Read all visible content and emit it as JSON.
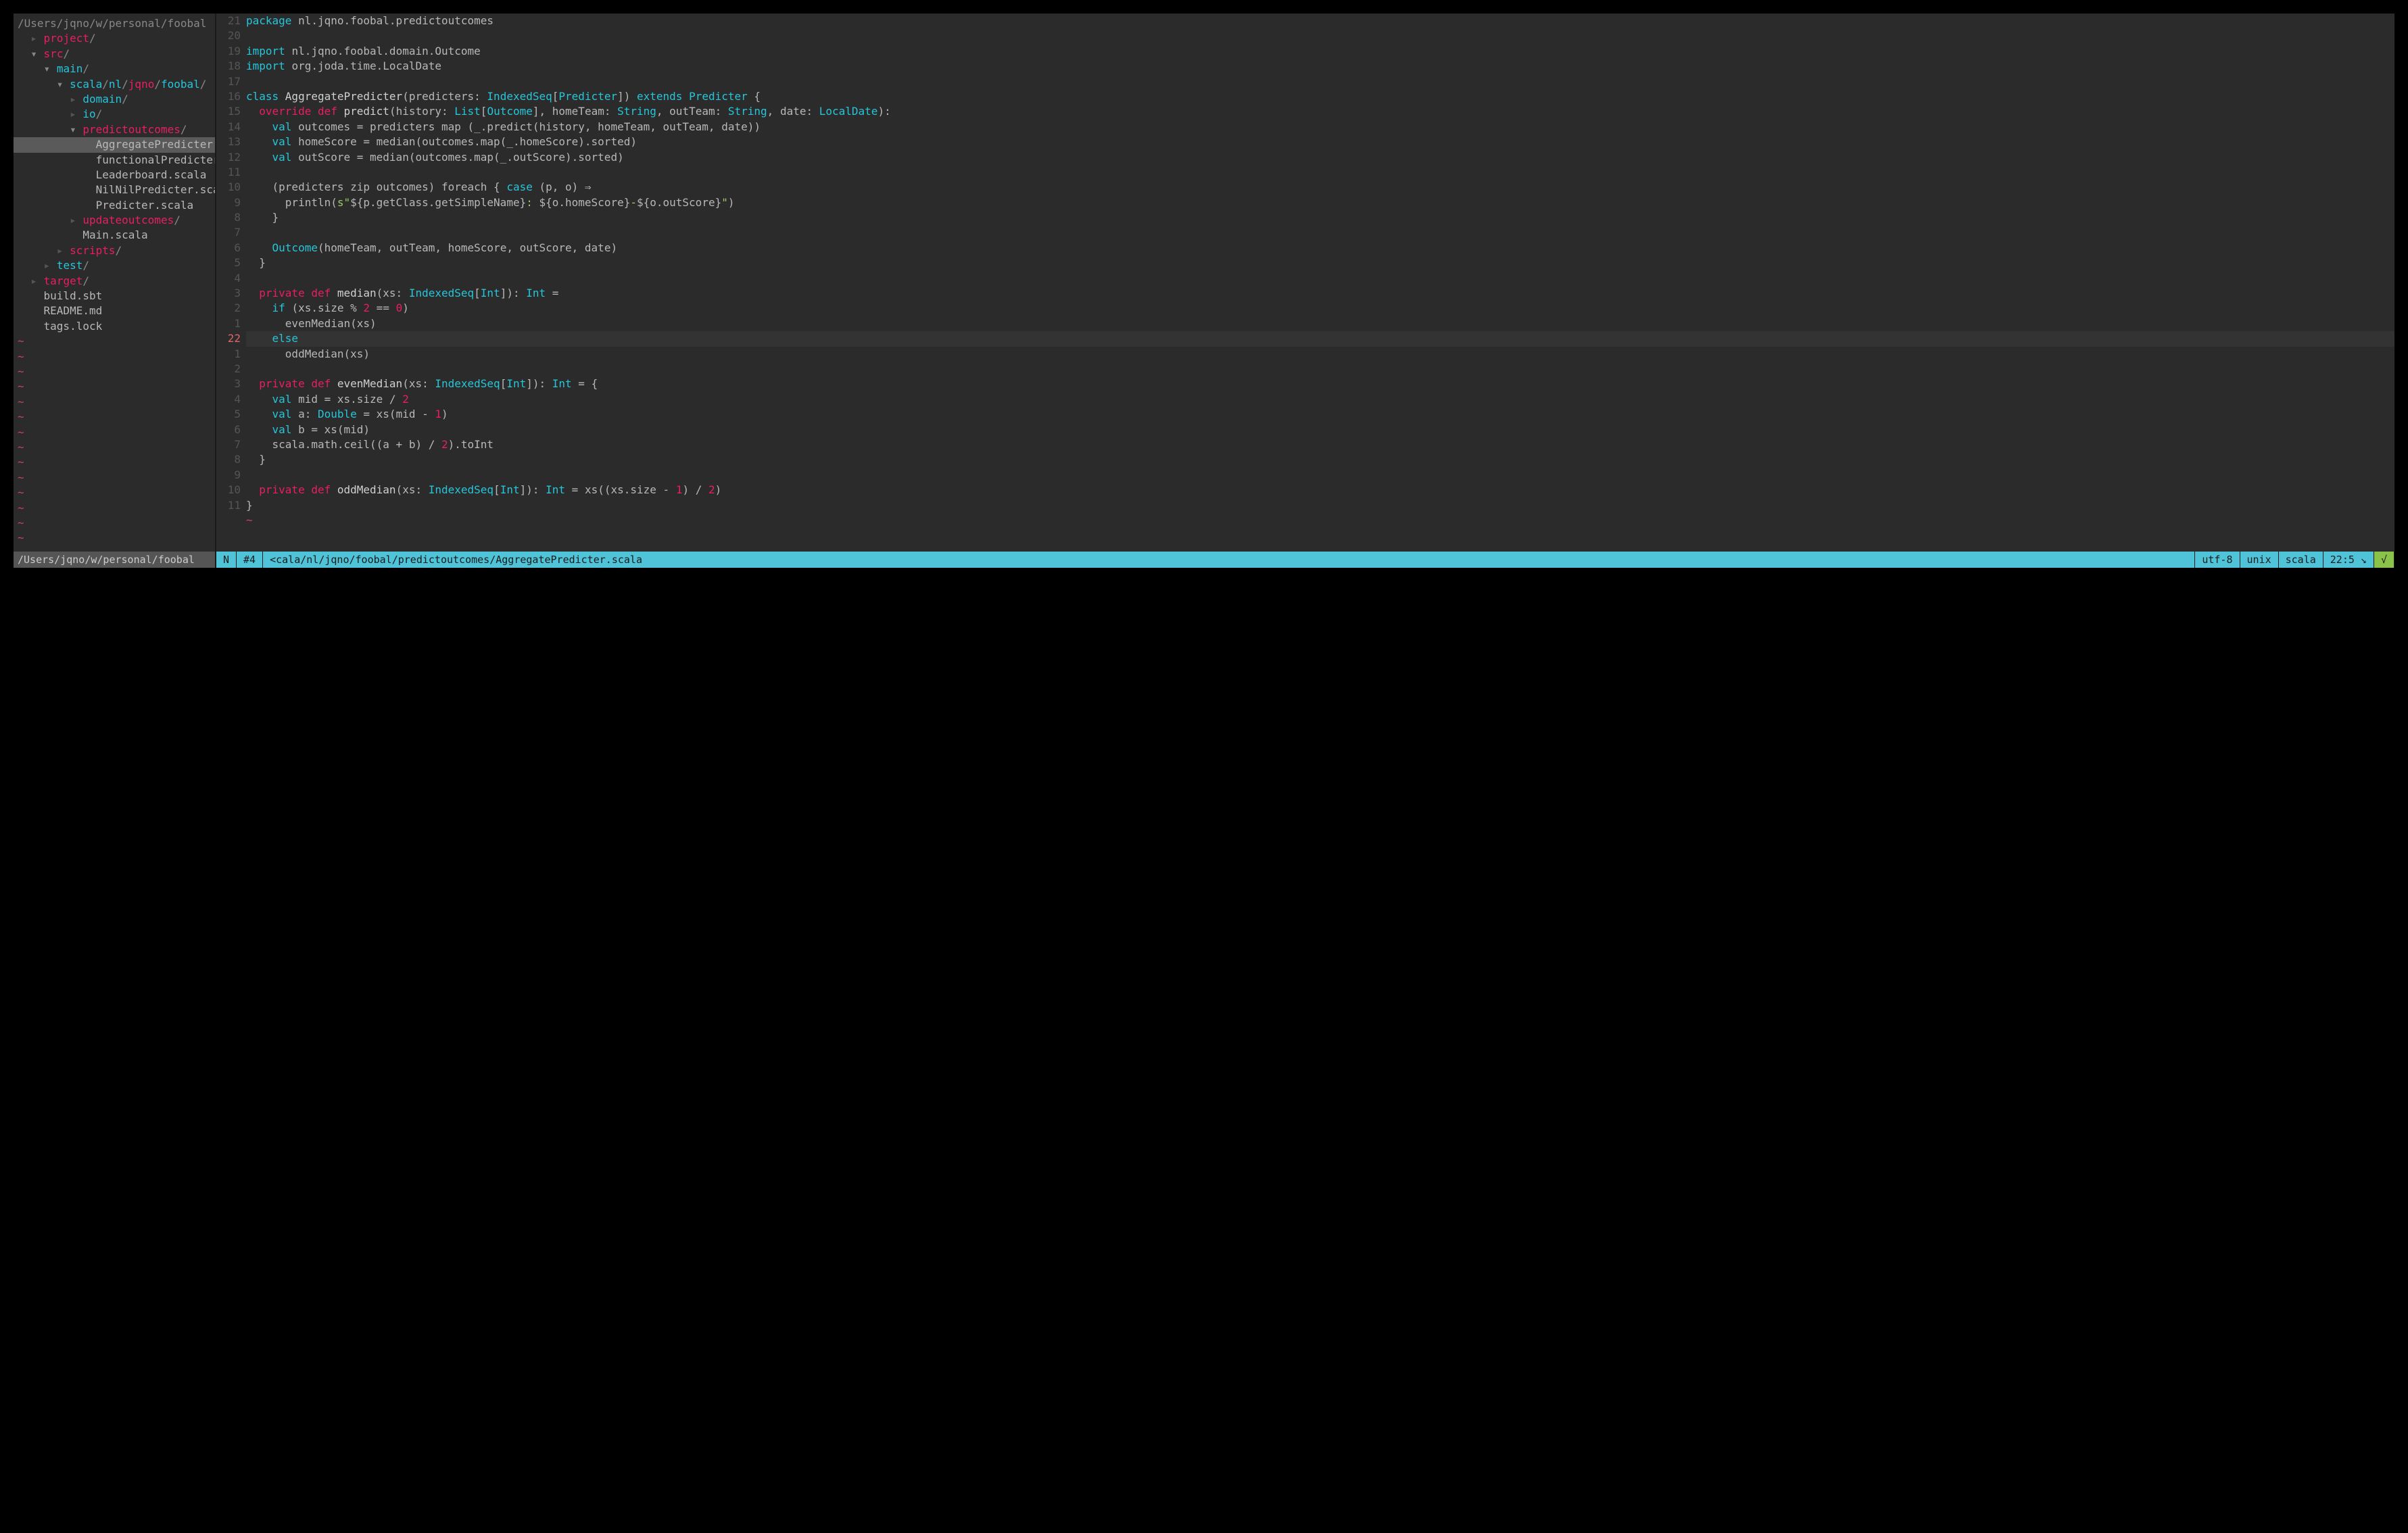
{
  "tree": {
    "root": "/Users/jqno/w/personal/foobal",
    "items": [
      {
        "indent": 1,
        "arrow": "▸",
        "text": "project",
        "type": "dir"
      },
      {
        "indent": 1,
        "arrow": "▾",
        "text": "src",
        "type": "dir"
      },
      {
        "indent": 2,
        "arrow": "▾",
        "text": "main",
        "type": "dir-alt"
      },
      {
        "indent": 3,
        "arrow": "▾",
        "segments": [
          {
            "t": "scala",
            "c": "dir-alt"
          },
          {
            "t": "/",
            "c": "slash"
          },
          {
            "t": "nl",
            "c": "dir-alt"
          },
          {
            "t": "/",
            "c": "slash"
          },
          {
            "t": "jqno",
            "c": "dir"
          },
          {
            "t": "/",
            "c": "slash"
          },
          {
            "t": "foobal",
            "c": "dir-alt"
          },
          {
            "t": "/",
            "c": "slash"
          }
        ]
      },
      {
        "indent": 4,
        "arrow": "▸",
        "text": "domain",
        "type": "dir-alt"
      },
      {
        "indent": 4,
        "arrow": "▸",
        "text": "io",
        "type": "dir-alt"
      },
      {
        "indent": 4,
        "arrow": "▾",
        "text": "predictoutcomes",
        "type": "dir"
      },
      {
        "indent": 5,
        "text": "AggregatePredicter.",
        "type": "file",
        "selected": true
      },
      {
        "indent": 5,
        "text": "functionalPredicter",
        "type": "file"
      },
      {
        "indent": 5,
        "text": "Leaderboard.scala",
        "type": "file"
      },
      {
        "indent": 5,
        "text": "NilNilPredicter.sca",
        "type": "file"
      },
      {
        "indent": 5,
        "text": "Predicter.scala",
        "type": "file"
      },
      {
        "indent": 4,
        "arrow": "▸",
        "text": "updateoutcomes",
        "type": "dir"
      },
      {
        "indent": 4,
        "text": "Main.scala",
        "type": "file"
      },
      {
        "indent": 3,
        "arrow": "▸",
        "text": "scripts",
        "type": "dir"
      },
      {
        "indent": 2,
        "arrow": "▸",
        "text": "test",
        "type": "dir-alt"
      },
      {
        "indent": 1,
        "arrow": "▸",
        "text": "target",
        "type": "dir"
      },
      {
        "indent": 1,
        "text": "build.sbt",
        "type": "file"
      },
      {
        "indent": 1,
        "text": "README.md",
        "type": "file"
      },
      {
        "indent": 1,
        "text": "tags.lock",
        "type": "file"
      }
    ],
    "tilde_count": 14
  },
  "gutter": [
    "21",
    "20",
    "19",
    "18",
    "17",
    "16",
    "15",
    "14",
    "13",
    "12",
    "11",
    "10",
    "9",
    "8",
    "7",
    "6",
    "5",
    "4",
    "3",
    "2",
    "1",
    "22",
    "1",
    "2",
    "3",
    "4",
    "5",
    "6",
    "7",
    "8",
    "9",
    "10",
    "11"
  ],
  "cursor_gutter_index": 21,
  "code_lines": [
    [
      {
        "t": "package ",
        "c": "keyword"
      },
      {
        "t": "nl.jqno.foobal.predictoutcomes",
        "c": "plain"
      }
    ],
    [],
    [
      {
        "t": "import ",
        "c": "keyword"
      },
      {
        "t": "nl.jqno.foobal.domain.Outcome",
        "c": "plain"
      }
    ],
    [
      {
        "t": "import ",
        "c": "keyword"
      },
      {
        "t": "org.joda.time.LocalDate",
        "c": "plain"
      }
    ],
    [],
    [
      {
        "t": "class ",
        "c": "keyword"
      },
      {
        "t": "AggregatePredicter",
        "c": "fn"
      },
      {
        "t": "(predicters: ",
        "c": "plain"
      },
      {
        "t": "IndexedSeq",
        "c": "type"
      },
      {
        "t": "[",
        "c": "plain"
      },
      {
        "t": "Predicter",
        "c": "type"
      },
      {
        "t": "]) ",
        "c": "plain"
      },
      {
        "t": "extends ",
        "c": "keyword"
      },
      {
        "t": "Predicter",
        "c": "type"
      },
      {
        "t": " {",
        "c": "plain"
      }
    ],
    [
      {
        "t": "  ",
        "c": "plain"
      },
      {
        "t": "override def ",
        "c": "def"
      },
      {
        "t": "predict",
        "c": "fn"
      },
      {
        "t": "(history: ",
        "c": "plain"
      },
      {
        "t": "List",
        "c": "type"
      },
      {
        "t": "[",
        "c": "plain"
      },
      {
        "t": "Outcome",
        "c": "type"
      },
      {
        "t": "], homeTeam: ",
        "c": "plain"
      },
      {
        "t": "String",
        "c": "type"
      },
      {
        "t": ", outTeam: ",
        "c": "plain"
      },
      {
        "t": "String",
        "c": "type"
      },
      {
        "t": ", date: ",
        "c": "plain"
      },
      {
        "t": "LocalDate",
        "c": "type"
      },
      {
        "t": "):",
        "c": "plain"
      }
    ],
    [
      {
        "t": "    ",
        "c": "plain"
      },
      {
        "t": "val ",
        "c": "keyword"
      },
      {
        "t": "outcomes = predicters map (_.predict(history, homeTeam, outTeam, date))",
        "c": "plain"
      }
    ],
    [
      {
        "t": "    ",
        "c": "plain"
      },
      {
        "t": "val ",
        "c": "keyword"
      },
      {
        "t": "homeScore = median(outcomes.map(_.homeScore).sorted)",
        "c": "plain"
      }
    ],
    [
      {
        "t": "    ",
        "c": "plain"
      },
      {
        "t": "val ",
        "c": "keyword"
      },
      {
        "t": "outScore = median(outcomes.map(_.outScore).sorted)",
        "c": "plain"
      }
    ],
    [],
    [
      {
        "t": "    (predicters zip outcomes) foreach { ",
        "c": "plain"
      },
      {
        "t": "case ",
        "c": "keyword"
      },
      {
        "t": "(p, o) ",
        "c": "plain"
      },
      {
        "t": "⇒",
        "c": "op"
      }
    ],
    [
      {
        "t": "      println(",
        "c": "plain"
      },
      {
        "t": "s\"",
        "c": "string"
      },
      {
        "t": "${p.getClass.getSimpleName}",
        "c": "interp"
      },
      {
        "t": ": ",
        "c": "string"
      },
      {
        "t": "${o.homeScore}",
        "c": "interp"
      },
      {
        "t": "-",
        "c": "string"
      },
      {
        "t": "${o.outScore}",
        "c": "interp"
      },
      {
        "t": "\"",
        "c": "string"
      },
      {
        "t": ")",
        "c": "plain"
      }
    ],
    [
      {
        "t": "    }",
        "c": "plain"
      }
    ],
    [],
    [
      {
        "t": "    ",
        "c": "plain"
      },
      {
        "t": "Outcome",
        "c": "type"
      },
      {
        "t": "(homeTeam, outTeam, homeScore, outScore, date)",
        "c": "plain"
      }
    ],
    [
      {
        "t": "  }",
        "c": "plain"
      }
    ],
    [],
    [
      {
        "t": "  ",
        "c": "plain"
      },
      {
        "t": "private def ",
        "c": "def"
      },
      {
        "t": "median",
        "c": "fn"
      },
      {
        "t": "(xs: ",
        "c": "plain"
      },
      {
        "t": "IndexedSeq",
        "c": "type"
      },
      {
        "t": "[",
        "c": "plain"
      },
      {
        "t": "Int",
        "c": "type"
      },
      {
        "t": "]): ",
        "c": "plain"
      },
      {
        "t": "Int",
        "c": "type"
      },
      {
        "t": " =",
        "c": "plain"
      }
    ],
    [
      {
        "t": "    ",
        "c": "plain"
      },
      {
        "t": "if ",
        "c": "keyword"
      },
      {
        "t": "(xs.size % ",
        "c": "plain"
      },
      {
        "t": "2",
        "c": "number"
      },
      {
        "t": " == ",
        "c": "plain"
      },
      {
        "t": "0",
        "c": "number"
      },
      {
        "t": ")",
        "c": "plain"
      }
    ],
    [
      {
        "t": "      evenMedian(xs)",
        "c": "plain"
      }
    ],
    [
      {
        "t": "    ",
        "c": "plain"
      },
      {
        "t": "else",
        "c": "keyword"
      }
    ],
    [
      {
        "t": "      oddMedian(xs)",
        "c": "plain"
      }
    ],
    [],
    [
      {
        "t": "  ",
        "c": "plain"
      },
      {
        "t": "private def ",
        "c": "def"
      },
      {
        "t": "evenMedian",
        "c": "fn"
      },
      {
        "t": "(xs: ",
        "c": "plain"
      },
      {
        "t": "IndexedSeq",
        "c": "type"
      },
      {
        "t": "[",
        "c": "plain"
      },
      {
        "t": "Int",
        "c": "type"
      },
      {
        "t": "]): ",
        "c": "plain"
      },
      {
        "t": "Int",
        "c": "type"
      },
      {
        "t": " = {",
        "c": "plain"
      }
    ],
    [
      {
        "t": "    ",
        "c": "plain"
      },
      {
        "t": "val ",
        "c": "keyword"
      },
      {
        "t": "mid = xs.size / ",
        "c": "plain"
      },
      {
        "t": "2",
        "c": "number"
      }
    ],
    [
      {
        "t": "    ",
        "c": "plain"
      },
      {
        "t": "val ",
        "c": "keyword"
      },
      {
        "t": "a: ",
        "c": "plain"
      },
      {
        "t": "Double",
        "c": "type"
      },
      {
        "t": " = xs(mid - ",
        "c": "plain"
      },
      {
        "t": "1",
        "c": "number"
      },
      {
        "t": ")",
        "c": "plain"
      }
    ],
    [
      {
        "t": "    ",
        "c": "plain"
      },
      {
        "t": "val ",
        "c": "keyword"
      },
      {
        "t": "b = xs(mid)",
        "c": "plain"
      }
    ],
    [
      {
        "t": "    scala.math.ceil((a + b) / ",
        "c": "plain"
      },
      {
        "t": "2",
        "c": "number"
      },
      {
        "t": ").toInt",
        "c": "plain"
      }
    ],
    [
      {
        "t": "  }",
        "c": "plain"
      }
    ],
    [],
    [
      {
        "t": "  ",
        "c": "plain"
      },
      {
        "t": "private def ",
        "c": "def"
      },
      {
        "t": "oddMedian",
        "c": "fn"
      },
      {
        "t": "(xs: ",
        "c": "plain"
      },
      {
        "t": "IndexedSeq",
        "c": "type"
      },
      {
        "t": "[",
        "c": "plain"
      },
      {
        "t": "Int",
        "c": "type"
      },
      {
        "t": "]): ",
        "c": "plain"
      },
      {
        "t": "Int",
        "c": "type"
      },
      {
        "t": " = xs((xs.size - ",
        "c": "plain"
      },
      {
        "t": "1",
        "c": "number"
      },
      {
        "t": ") / ",
        "c": "plain"
      },
      {
        "t": "2",
        "c": "number"
      },
      {
        "t": ")",
        "c": "plain"
      }
    ],
    [
      {
        "t": "}",
        "c": "plain"
      }
    ]
  ],
  "code_tilde": "~",
  "status": {
    "left": "/Users/jqno/w/personal/foobal",
    "mode": "N",
    "bufnum": "#4",
    "file": "<cala/nl/jqno/foobal/predictoutcomes/AggregatePredicter.scala",
    "encoding": "utf-8",
    "format": "unix",
    "filetype": "scala",
    "position": "22:5 ↘",
    "check": "√"
  }
}
